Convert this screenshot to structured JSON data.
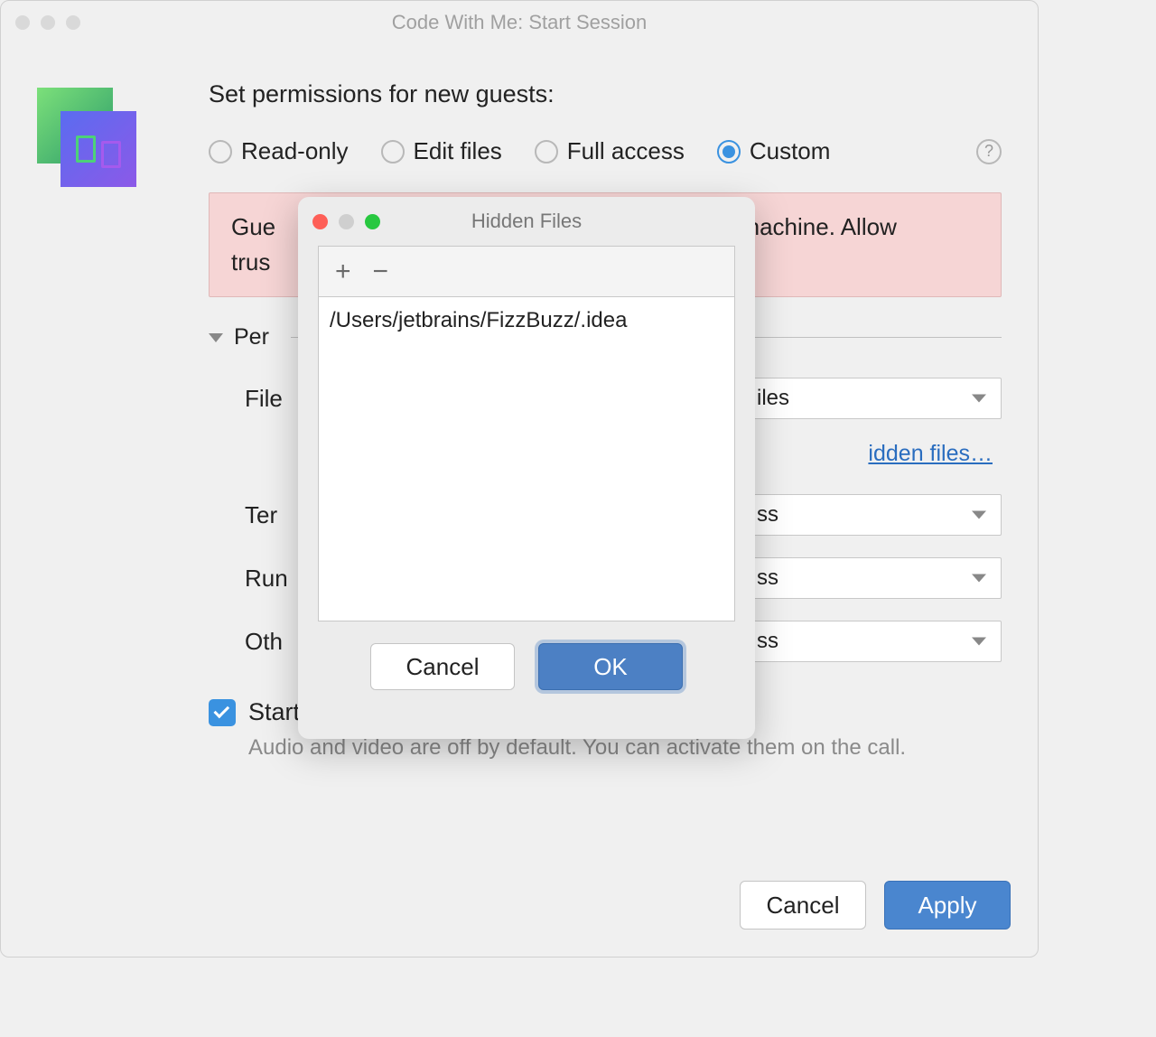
{
  "mainWindow": {
    "title": "Code With Me: Start Session"
  },
  "permissions": {
    "heading": "Set permissions for new guests:",
    "options": {
      "readonly": "Read-only",
      "edit": "Edit files",
      "full": "Full access",
      "custom": "Custom"
    },
    "selected": "custom"
  },
  "warning": {
    "prefix": "Gue",
    "suffixTop": "nachine. Allow",
    "line2prefix": "trus"
  },
  "permSection": {
    "label": "Per"
  },
  "rows": {
    "file": {
      "label": "File",
      "valueSuffix": "iles"
    },
    "terminal": {
      "label": "Ter",
      "valueSuffix": "ss"
    },
    "run": {
      "label": "Run",
      "valueSuffix": "ss"
    },
    "other": {
      "label": "Oth",
      "valueSuffix": "ss"
    }
  },
  "hiddenFilesLink": "idden files…",
  "startCall": {
    "label": "Start call",
    "sub": "Audio and video are off by default. You can activate them on the call."
  },
  "footer": {
    "cancel": "Cancel",
    "apply": "Apply"
  },
  "modal": {
    "title": "Hidden Files",
    "items": [
      "/Users/jetbrains/FizzBuzz/.idea"
    ],
    "cancel": "Cancel",
    "ok": "OK"
  }
}
